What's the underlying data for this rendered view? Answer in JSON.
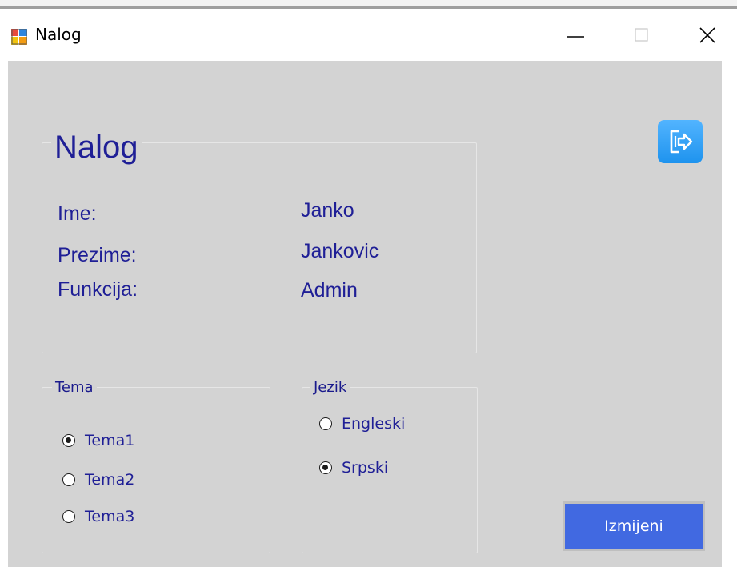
{
  "window": {
    "title": "Nalog",
    "controls": {
      "minimize": "minimize-icon",
      "maximize": "maximize-icon",
      "close": "close-icon"
    }
  },
  "account": {
    "heading": "Nalog",
    "fields": [
      {
        "label": "Ime:",
        "value": "Janko"
      },
      {
        "label": "Prezime:",
        "value": "Jankovic"
      },
      {
        "label": "Funkcija:",
        "value": "Admin"
      }
    ]
  },
  "theme_group": {
    "title": "Tema",
    "options": [
      {
        "label": "Tema1",
        "checked": true
      },
      {
        "label": "Tema2",
        "checked": false
      },
      {
        "label": "Tema3",
        "checked": false
      }
    ]
  },
  "language_group": {
    "title": "Jezik",
    "options": [
      {
        "label": "Engleski",
        "checked": false
      },
      {
        "label": "Srpski",
        "checked": true
      }
    ]
  },
  "actions": {
    "logout_icon": "logout-icon",
    "edit_label": "Izmijeni"
  },
  "colors": {
    "background": "#d3d3d3",
    "text": "#1f1f96",
    "button": "#4169e1",
    "logout_button": "#2b9af3"
  }
}
